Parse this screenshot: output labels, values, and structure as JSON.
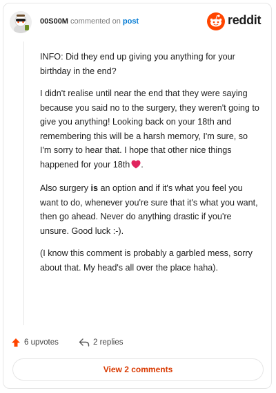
{
  "header": {
    "username": "00S00M",
    "action_text": "commented on",
    "post_link": "post",
    "brand": "reddit"
  },
  "comment": {
    "paragraphs": [
      "INFO: Did they end up giving you anything for your birthday in the end?",
      "I didn't realise until near the end that they were saying because you said no to the surgery, they weren't going to give you anything! Looking back on your 18th and remembering this will be a harsh memory, I'm sure, so I'm sorry to hear that. I hope that other nice things happened for your 18th"
    ],
    "p3_before": "Also surgery ",
    "p3_bold": "is",
    "p3_after": " an option and if it's what you feel you want to do, whenever you're sure that it's what you want, then go ahead. Never do anything drastic if you're unsure. Good luck :-).",
    "p4": "(I know this comment is probably a garbled mess, sorry about that. My head's all over the place haha)."
  },
  "actions": {
    "upvotes": "6 upvotes",
    "replies": "2 replies"
  },
  "view_comments": "View 2 comments",
  "colors": {
    "accent_orange": "#ff4500",
    "link_blue": "#0079d3",
    "button_text": "#d93900",
    "heart_red": "#e0245e"
  }
}
